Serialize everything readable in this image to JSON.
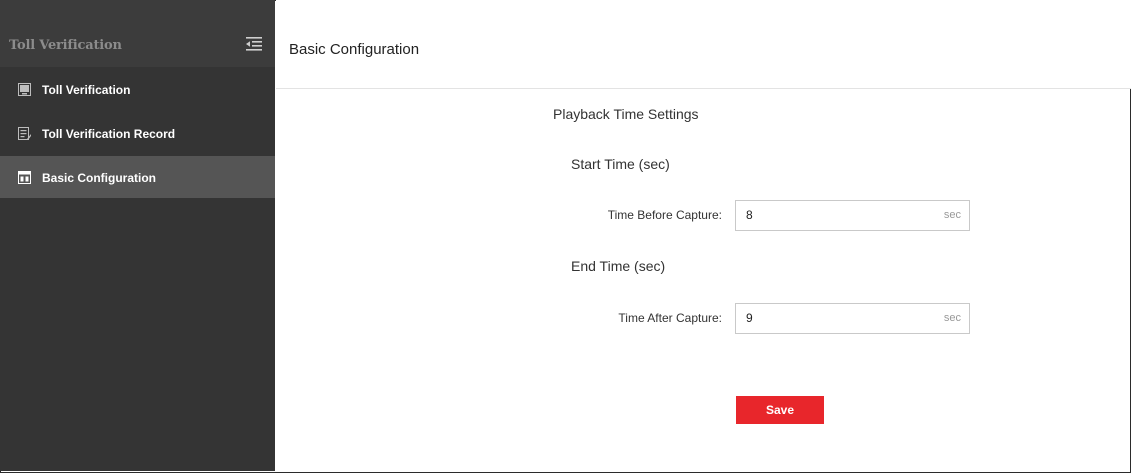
{
  "sidebar": {
    "title": "Toll Verification",
    "items": [
      {
        "label": "Toll Verification",
        "icon": "monitor-image-icon"
      },
      {
        "label": "Toll Verification Record",
        "icon": "record-list-icon"
      },
      {
        "label": "Basic Configuration",
        "icon": "config-window-icon"
      }
    ]
  },
  "main": {
    "title": "Basic Configuration",
    "section_title": "Playback Time Settings",
    "start_time_title": "Start Time (sec)",
    "time_before_label": "Time Before Capture:",
    "time_before_value": "8",
    "time_before_unit": "sec",
    "end_time_title": "End Time (sec)",
    "time_after_label": "Time After Capture:",
    "time_after_value": "9",
    "time_after_unit": "sec",
    "save_label": "Save"
  },
  "colors": {
    "sidebar_bg": "#343434",
    "sidebar_active": "#555555",
    "accent_button": "#e8262b"
  }
}
